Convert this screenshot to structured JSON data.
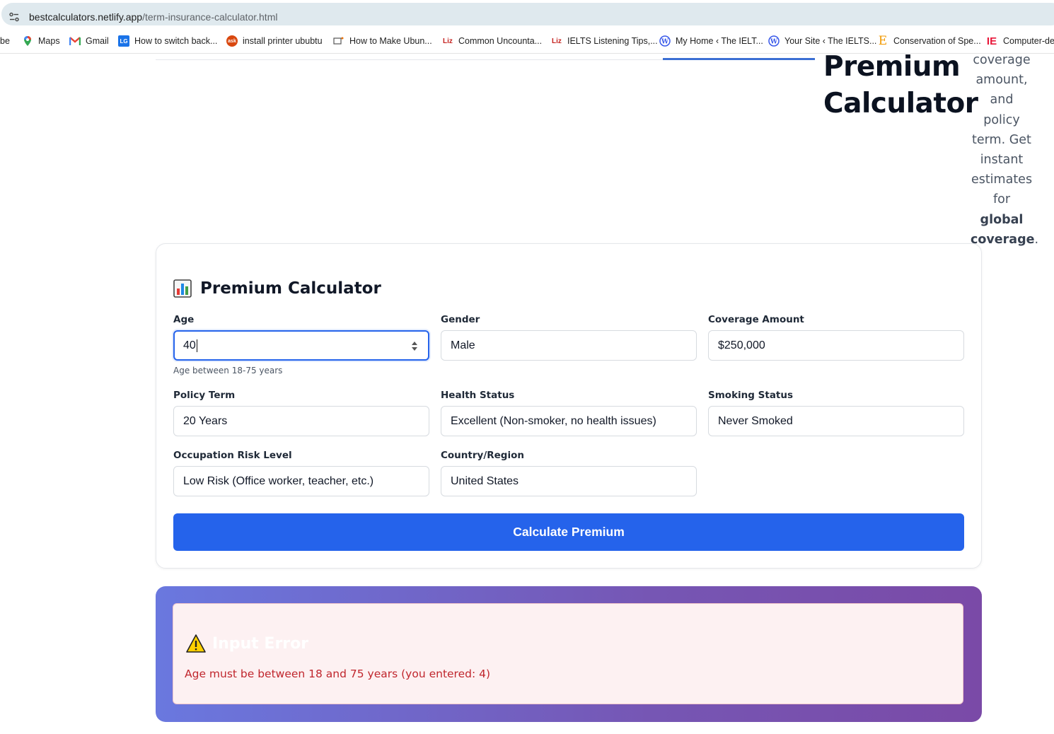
{
  "browser": {
    "url_host": "bestcalculators.netlify.app",
    "url_path": "/term-insurance-calculator.html",
    "bookmarks": [
      {
        "label": "be",
        "icon": "partial-icon"
      },
      {
        "label": "Maps",
        "icon": "maps-pin-icon"
      },
      {
        "label": "Gmail",
        "icon": "gmail-icon"
      },
      {
        "label": "How to switch back...",
        "icon": "lg-icon"
      },
      {
        "label": "install printer ububtu",
        "icon": "ask-icon"
      },
      {
        "label": "How to Make Ubun...",
        "icon": "page-icon"
      },
      {
        "label": "Common Uncounta...",
        "icon": "liz-icon"
      },
      {
        "label": "IELTS Listening Tips,...",
        "icon": "liz-icon"
      },
      {
        "label": "My Home ‹ The IELT...",
        "icon": "wordpress-icon"
      },
      {
        "label": "Your Site ‹ The IELTS...",
        "icon": "wordpress-icon"
      },
      {
        "label": "Conservation of Spe...",
        "icon": "e-icon"
      },
      {
        "label": "Computer-del",
        "icon": "ie-icon"
      }
    ]
  },
  "hero": {
    "title_line1": "Premium",
    "title_line2": "Calculator",
    "desc_lines": [
      "coverage",
      "amount,",
      "and policy",
      "term. Get",
      "instant",
      "estimates"
    ],
    "desc_for": "for",
    "desc_bold1": "global",
    "desc_bold2": "coverage",
    "desc_end": "."
  },
  "calculator": {
    "title": "Premium Calculator",
    "title_icon": "bar-chart-icon",
    "fields": {
      "age": {
        "label": "Age",
        "value": "40",
        "hint": "Age between 18-75 years"
      },
      "gender": {
        "label": "Gender",
        "value": "Male"
      },
      "coverage": {
        "label": "Coverage Amount",
        "value": "$250,000"
      },
      "term": {
        "label": "Policy Term",
        "value": "20 Years"
      },
      "health": {
        "label": "Health Status",
        "value": "Excellent (Non-smoker, no health issues)"
      },
      "smoking": {
        "label": "Smoking Status",
        "value": "Never Smoked"
      },
      "occupation": {
        "label": "Occupation Risk Level",
        "value": "Low Risk (Office worker, teacher, etc.)"
      },
      "country": {
        "label": "Country/Region",
        "value": "United States"
      }
    },
    "button_label": "Calculate Premium",
    "accent_color": "#2563eb"
  },
  "result": {
    "icon": "warning-icon",
    "title": "Input Error",
    "message": "Age must be between 18 and 75 years (you entered: 4)"
  }
}
